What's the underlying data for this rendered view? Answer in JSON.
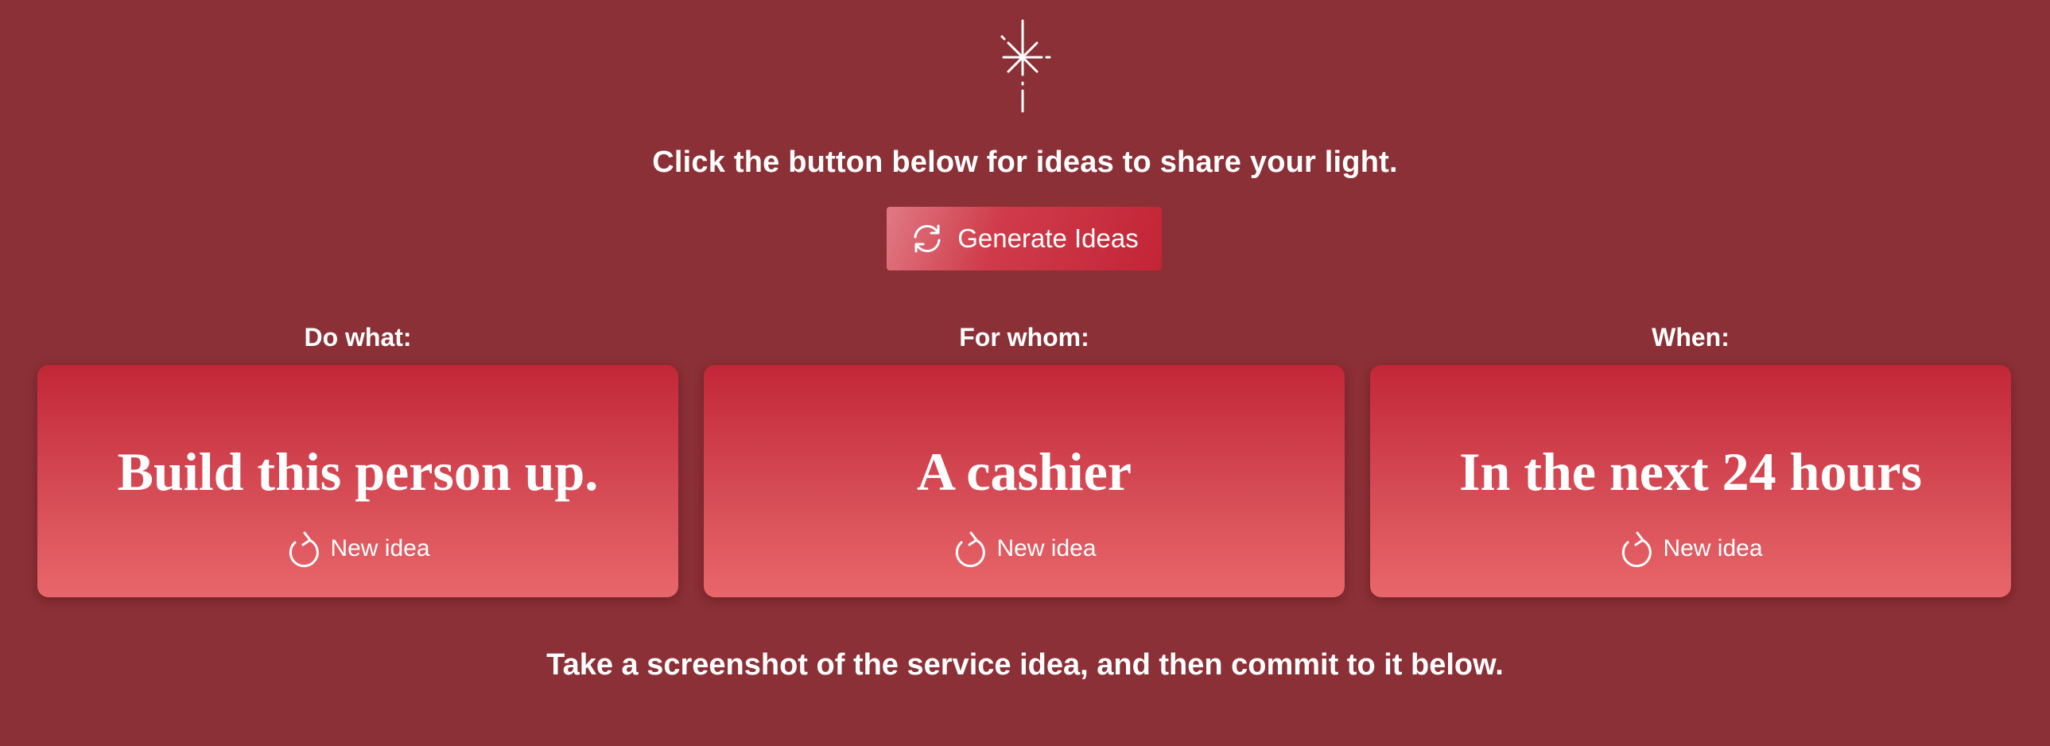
{
  "page": {
    "background_color": "#8b3036",
    "accent_color": "#c22536"
  },
  "header": {
    "icon": "sparkle-star-icon",
    "intro_text": "Click the button below for ideas to share your light."
  },
  "generate_button": {
    "icon": "refresh-cycle-icon",
    "label": "Generate Ideas"
  },
  "columns": [
    {
      "label": "Do what:",
      "value": "Build this person up.",
      "new_idea_label": "New idea",
      "new_idea_icon": "refresh-icon"
    },
    {
      "label": "For whom:",
      "value": "A cashier",
      "new_idea_label": "New idea",
      "new_idea_icon": "refresh-icon"
    },
    {
      "label": "When:",
      "value": "In the next 24 hours",
      "new_idea_label": "New idea",
      "new_idea_icon": "refresh-icon"
    }
  ],
  "footer": {
    "outro_text": "Take a screenshot of the service idea, and then commit to it below."
  }
}
